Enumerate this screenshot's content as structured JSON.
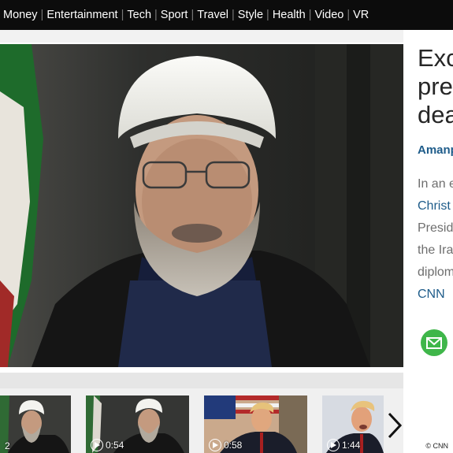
{
  "nav": {
    "items": [
      "Money",
      "Entertainment",
      "Tech",
      "Sport",
      "Travel",
      "Style",
      "Health",
      "Video",
      "VR"
    ],
    "separator": "|"
  },
  "article": {
    "headline_lines": [
      "Exc",
      "pre",
      "dea"
    ],
    "byline": "Amanp",
    "body_lines": [
      {
        "text": "In an e",
        "link": false
      },
      {
        "text": "Christ",
        "link": true
      },
      {
        "text": "Presid",
        "link": false
      },
      {
        "text": "the Ira",
        "link": false
      },
      {
        "text": "diplom",
        "link": false
      },
      {
        "text": "CNN",
        "link": true
      }
    ],
    "share_icon": "mail-icon"
  },
  "thumbnails": [
    {
      "duration": "2"
    },
    {
      "duration": "0:54"
    },
    {
      "duration": "0:58"
    },
    {
      "duration": "1:44"
    }
  ],
  "next_icon": "chevron-right-icon",
  "credit": "© CNN",
  "colors": {
    "nav_bg": "#0c0c0c",
    "link_blue": "#1e5c8a",
    "mail_green": "#3fb64a"
  }
}
